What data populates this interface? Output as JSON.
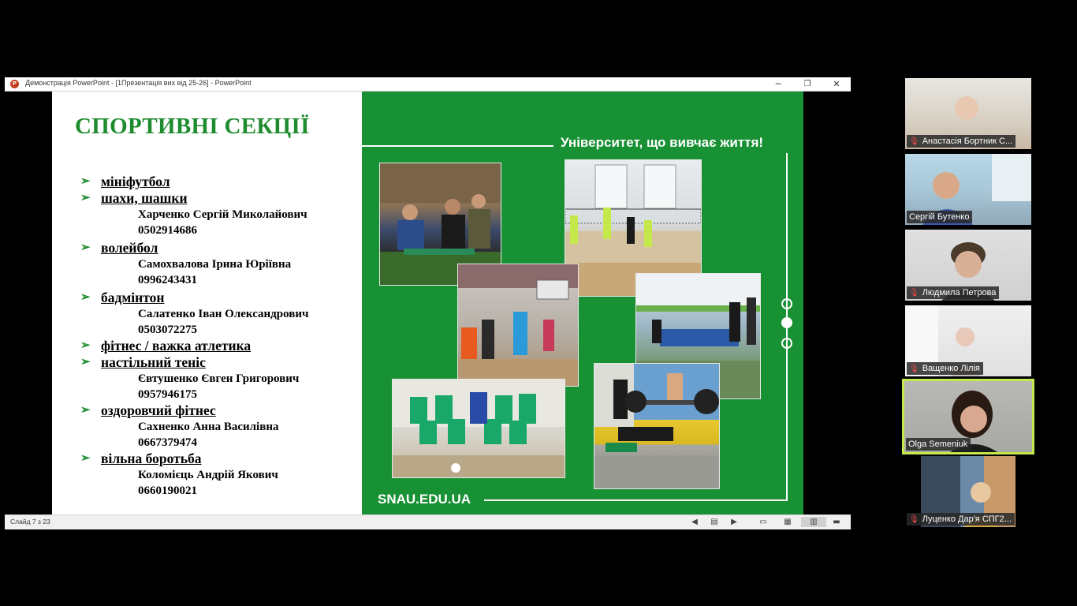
{
  "window": {
    "title": "Демонстрація PowerPoint - [1Презентація вих від 25-26] - PowerPoint",
    "app_icon": "P",
    "minimize_icon": "─",
    "maximize_icon": "❐",
    "close_icon": "✕"
  },
  "slide": {
    "title": "СПОРТИВНІ СЕКЦІЇ",
    "tagline": "Університет, що вивчає життя!",
    "url": "SNAU.EDU.UA",
    "bullet_glyph": "➢",
    "sections": [
      {
        "name": "мініфутбол",
        "details": []
      },
      {
        "name": "шахи, шашки",
        "details": [
          "Харченко Сергій Миколайович",
          "0502914686"
        ]
      },
      {
        "name": "волейбол",
        "details": [
          "Самохвалова Ірина Юріївна",
          "0996243431"
        ]
      },
      {
        "name": "бадмінтон",
        "details": [
          "Салатенко Іван Олександрович",
          "0503072275"
        ]
      },
      {
        "name": "фітнес / важка атлетика",
        "details": []
      },
      {
        "name": "настільний теніс",
        "details": [
          "Євтушенко Євген Григорович",
          "0957946175"
        ]
      },
      {
        "name": "оздоровчий фітнес",
        "details": [
          "Сахненко Анна Василівна",
          "0667379474"
        ]
      },
      {
        "name": "вільна боротьба",
        "details": [
          "Коломієць Андрій Якович",
          "0660190021"
        ]
      }
    ]
  },
  "statusbar": {
    "slide_counter": "Слайд 7 з 23",
    "icons": [
      "prev-icon",
      "notes-icon",
      "next-icon",
      "normal-view-icon",
      "slide-sorter-icon",
      "reading-view-icon",
      "slideshow-icon"
    ]
  },
  "participants": [
    {
      "name": "Анастасія Бортник С...",
      "muted": true,
      "active": false
    },
    {
      "name": "Сергій Бутенко",
      "muted": false,
      "active": false
    },
    {
      "name": "Людмила Петрова",
      "muted": true,
      "active": false
    },
    {
      "name": "Ващенко Лілія",
      "muted": true,
      "active": false
    },
    {
      "name": "Olga Semeniuk",
      "muted": false,
      "active": true
    },
    {
      "name": "Луценко Дар'я СПГ2...",
      "muted": true,
      "active": false
    }
  ],
  "colors": {
    "slide_green": "#189034",
    "title_green": "#1e8c2e",
    "active_speaker": "#c5e84a"
  }
}
